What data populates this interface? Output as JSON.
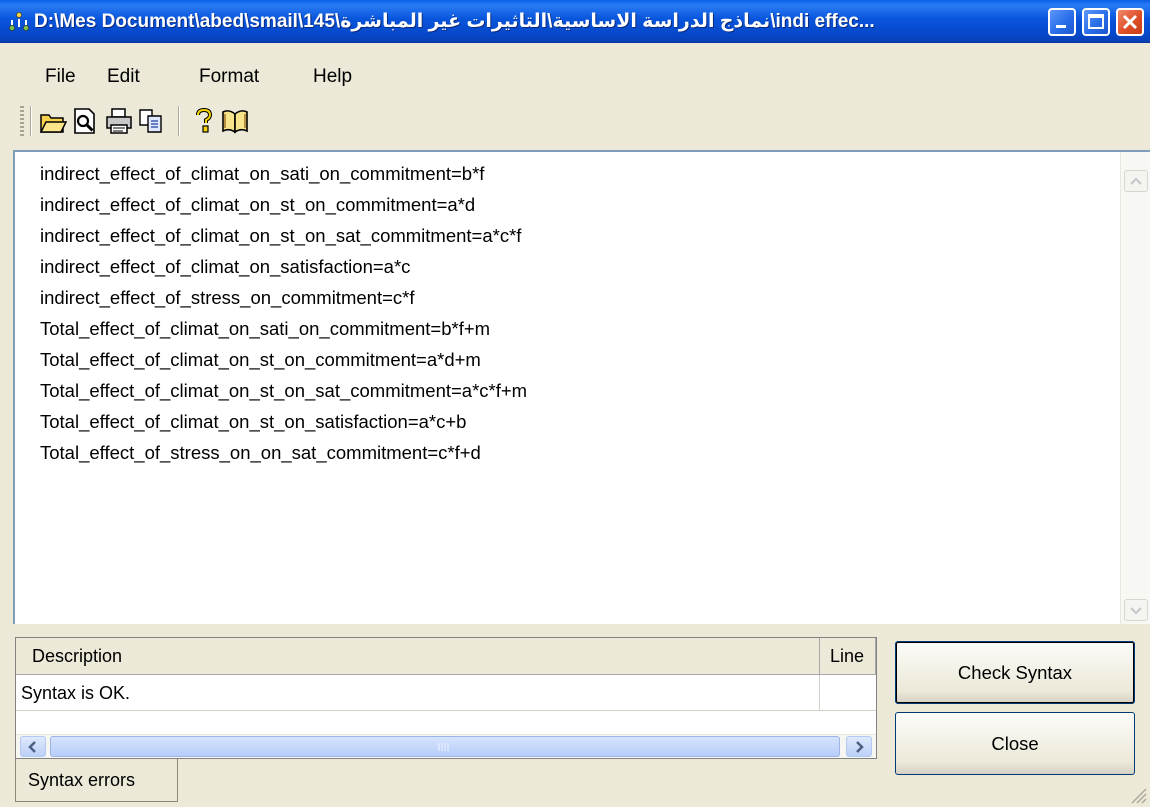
{
  "window": {
    "title": "D:\\Mes Document\\abed\\smail\\145\\نماذج الدراسة الاساسية\\التاثيرات غير المباشرة\\indi effec..."
  },
  "menu": {
    "items": [
      "File",
      "Edit",
      "Format",
      "Help"
    ]
  },
  "toolbar": {
    "icons": [
      "open-folder-icon",
      "print-preview-icon",
      "print-icon",
      "copy-icon",
      "help-icon",
      "book-icon"
    ]
  },
  "editor": {
    "lines": [
      "indirect_effect_of_climat_on_sati_on_commitment=b*f",
      "indirect_effect_of_climat_on_st_on_commitment=a*d",
      "indirect_effect_of_climat_on_st_on_sat_commitment=a*c*f",
      "indirect_effect_of_climat_on_satisfaction=a*c",
      "indirect_effect_of_stress_on_commitment=c*f",
      "Total_effect_of_climat_on_sati_on_commitment=b*f+m",
      "Total_effect_of_climat_on_st_on_commitment=a*d+m",
      "Total_effect_of_climat_on_st_on_sat_commitment=a*c*f+m",
      "Total_effect_of_climat_on_st_on_satisfaction=a*c+b",
      "Total_effect_of_stress_on_on_sat_commitment=c*f+d"
    ]
  },
  "errors": {
    "columns": {
      "description": "Description",
      "line": "Line"
    },
    "rows": [
      {
        "description": "Syntax is OK.",
        "line": ""
      }
    ],
    "tab_label": "Syntax errors"
  },
  "buttons": {
    "check_syntax": "Check Syntax",
    "close": "Close"
  },
  "colors": {
    "titlebar": "#0855dc",
    "close_button": "#de4f27",
    "window_face": "#ece9d8",
    "editor_border": "#7f9db9"
  }
}
